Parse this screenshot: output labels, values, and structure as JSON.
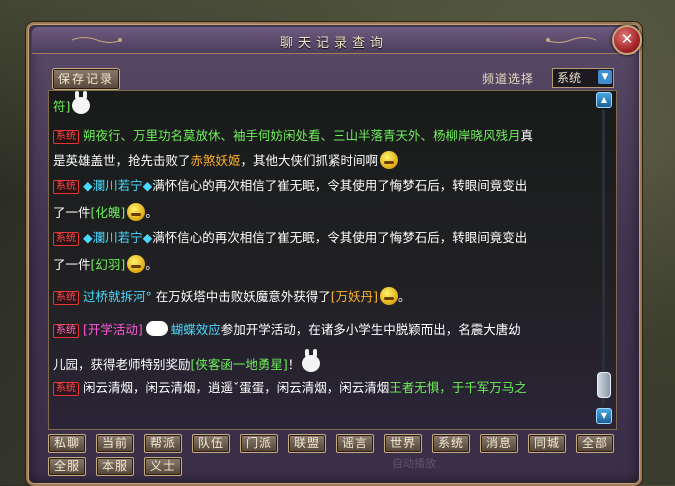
{
  "window": {
    "title": "聊天记录查询"
  },
  "toolbar": {
    "save_label": "保存记录",
    "channel_label": "频道选择",
    "channel_value": "系统"
  },
  "chat": {
    "tag_label": "系统",
    "lines": [
      {
        "segments": [
          {
            "text": "符]",
            "color": "#6ef05a"
          }
        ]
      },
      {
        "segments": [
          {
            "text": "朔夜行、万里功名莫放休、袖手何妨闲处看、三山半落青天外、杨柳岸晓风残月",
            "color": "#6ef05a"
          },
          {
            "text": "真",
            "color": "#ffffff"
          }
        ]
      },
      {
        "segments": [
          {
            "text": "是英雄盖世，抢先击败了",
            "color": "#ffffff"
          },
          {
            "text": "赤煞妖姬",
            "color": "#ffb12c"
          },
          {
            "text": "，其他大侠们抓紧时间啊",
            "color": "#ffffff"
          }
        ]
      },
      {
        "segments": [
          {
            "text": "◆瀾川若宁◆",
            "color": "#49d9ff"
          },
          {
            "text": "满怀信心的再次相信了崔无眠，令其使用了悔梦石后，转眼间竟变出",
            "color": "#ffffff"
          }
        ]
      },
      {
        "segments": [
          {
            "text": "了一件",
            "color": "#ffffff"
          },
          {
            "text": "[化魄]",
            "color": "#6ef05a"
          }
        ]
      },
      {
        "segments": [
          {
            "text": "◆瀾川若宁◆",
            "color": "#49d9ff"
          },
          {
            "text": "满怀信心的再次相信了崔无眠，令其使用了悔梦石后，转眼间竟变出",
            "color": "#ffffff"
          }
        ]
      },
      {
        "segments": [
          {
            "text": "了一件",
            "color": "#ffffff"
          },
          {
            "text": "[幻羽]",
            "color": "#6ef05a"
          }
        ]
      },
      {
        "segments": [
          {
            "text": "过桥就拆河°",
            "color": "#49d9ff"
          },
          {
            "text": "在万妖塔中击败妖魔意外获得了",
            "color": "#ffffff"
          },
          {
            "text": "[万妖丹]",
            "color": "#ffb12c"
          }
        ]
      },
      {
        "segments": [
          {
            "text": "[开学活动]",
            "color": "#ff5ad8"
          },
          {
            "text": "蝴蝶效应",
            "color": "#49d9ff"
          },
          {
            "text": "参加开学活动，在诸多小学生中脱颖而出，名震大唐幼",
            "color": "#ffffff"
          }
        ]
      },
      {
        "segments": [
          {
            "text": "儿园，获得老师特别奖励",
            "color": "#ffffff"
          },
          {
            "text": "[侠客函一地勇星]",
            "color": "#6ef05a"
          }
        ]
      },
      {
        "segments": [
          {
            "text": "闲云清烟，闲云清烟，逍遥ˇ蛋蛋，闲云清烟，闲云清烟",
            "color": "#ffffff"
          },
          {
            "text": "王者无惧，于千军万马之",
            "color": "#6ef05a"
          }
        ]
      }
    ]
  },
  "filters": {
    "row1": [
      "私聊",
      "当前",
      "帮派",
      "队伍",
      "门派",
      "联盟",
      "谣言",
      "世界",
      "系统",
      "消息",
      "同城",
      "全部"
    ],
    "row2": [
      "全服",
      "本服",
      "义士"
    ]
  },
  "watermark": "自动播放"
}
